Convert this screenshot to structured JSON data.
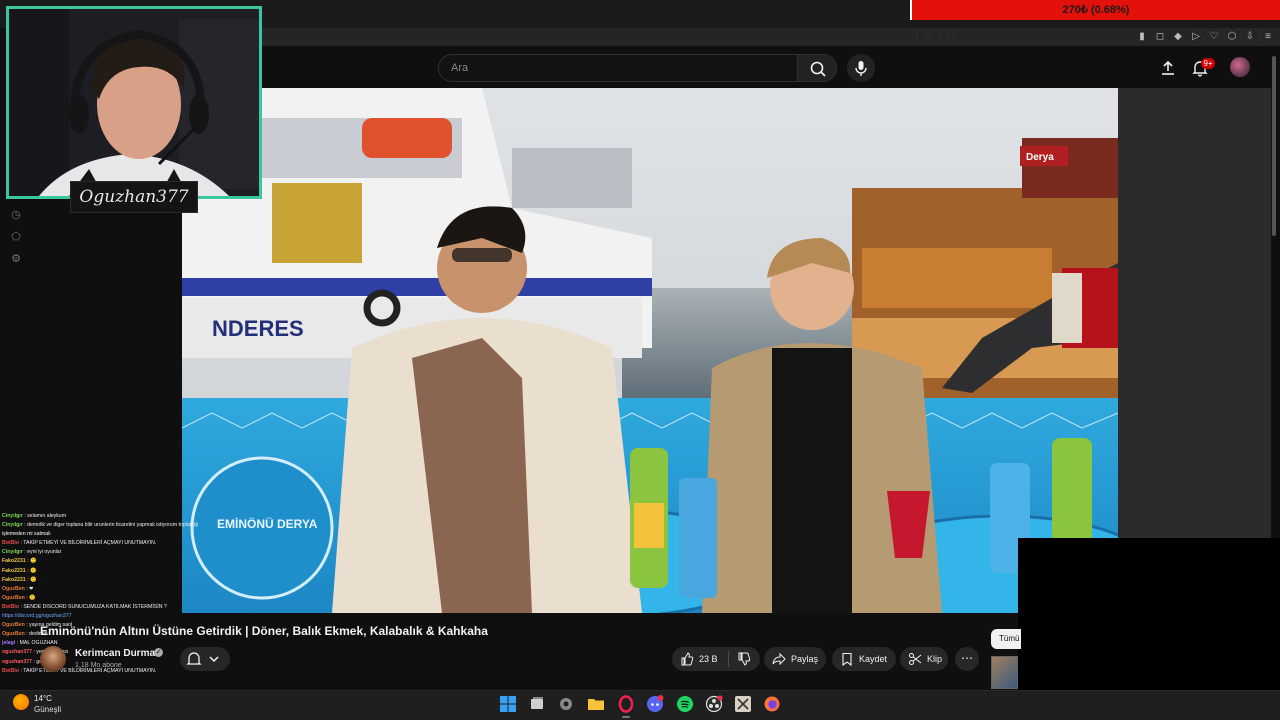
{
  "browser": {
    "donation_text": "270₺ (0.68%)",
    "ticker_left": "TRY0",
    "ticker_right": "0X40001"
  },
  "youtube": {
    "search_placeholder": "Ara",
    "notification_count": "9+"
  },
  "webcam": {
    "streamer_name": "Oguzhan377",
    "frame_color": "#3cc69f"
  },
  "chat": [
    {
      "user": "Cinyılgır",
      "text": ": selamın aleykum",
      "color": "#7ed957"
    },
    {
      "user": "Cinyılgır",
      "text": ": demolik ve diger toplana bilir urunlerin ticaretini yapmak istiyorum toplattığı",
      "color": "#7ed957"
    },
    {
      "user": "",
      "text": "işlemeden mi satmalı",
      "color": "#ffffff"
    },
    {
      "user": "BotBlo",
      "text": ": TAKİP ETMEYİ VE BİLDİRİMLERİ AÇMAYI UNUTMAYIN.",
      "color": "#e84a4a"
    },
    {
      "user": "Cinyılgır",
      "text": ": eyni iyi oyunlar",
      "color": "#7ed957"
    },
    {
      "user": "Fako2231",
      "text": ": 🙂",
      "color": "#f5c242"
    },
    {
      "user": "Fako2231",
      "text": ": 🙂",
      "color": "#f5c242"
    },
    {
      "user": "Fako2231",
      "text": ": 🙂",
      "color": "#f5c242"
    },
    {
      "user": "OguzBen",
      "text": ": ❤",
      "color": "#e87a3a"
    },
    {
      "user": "OguzBen",
      "text": ": 🙂",
      "color": "#e87a3a"
    },
    {
      "user": "BotBlo",
      "text": ": SENDE DISCORD SUNUCUMUZA KATILMAK İSTERMİSİN ?",
      "color": "#e84a4a"
    },
    {
      "user": "",
      "text": "https://discord.gg/oguzhan377",
      "color": "#6fa8ff"
    },
    {
      "user": "OguzBen",
      "text": ": yayına geldim saol",
      "color": "#e87a3a"
    },
    {
      "user": "OguzBen",
      "text": ": dedimm",
      "color": "#e87a3a"
    },
    {
      "user": "jelagi",
      "text": ": MAL OGUZHAN",
      "color": "#9d7bff"
    },
    {
      "user": "oguzhan377",
      "text": ": yemek molası",
      "color": "#ff5b5b"
    },
    {
      "user": "oguzhan377",
      "text": ": geldim :D",
      "color": "#ff5b5b"
    },
    {
      "user": "BotBlo",
      "text": ": TAKİP ETMEYİ VE BİLDİRİMLERİ AÇMAYI UNUTMAYIN.",
      "color": "#e84a4a"
    }
  ],
  "video": {
    "title": "Eminönü'nün Altını Üstüne Getirdik | Döner, Balık Ekmek, Kalabalık & Kahkaha",
    "channel_name": "Kerimcan Durmaz",
    "subscribers": "1,18 Mn abone",
    "like_count": "23 B",
    "share_label": "Paylaş",
    "save_label": "Kaydet",
    "clip_label": "Klip",
    "more_label": "⋯",
    "side_chip": "Tümü"
  },
  "taskbar": {
    "temperature": "14°C",
    "weather": "Güneşli"
  },
  "colors": {
    "accent_red": "#e4110b",
    "background": "#0f0f0f",
    "pill": "#272727"
  }
}
